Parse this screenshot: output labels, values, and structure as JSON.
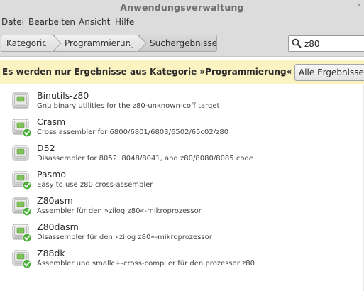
{
  "window": {
    "title": "Anwendungsverwaltung"
  },
  "menu": [
    "Datei",
    "Bearbeiten",
    "Ansicht",
    "Hilfe"
  ],
  "breadcrumbs": [
    "Kategorien",
    "Programmierung",
    "Suchergebnisse"
  ],
  "search": {
    "value": "z80",
    "icon": "search-icon"
  },
  "infobar": {
    "message": "Es werden nur Ergebnisse aus Kategorie »Programmierung« angezeigt.",
    "button_label": "Alle Ergebnisse anzeigen"
  },
  "packages": [
    {
      "name": "Binutils-z80",
      "description": "Gnu binary utilities for the z80-unknown-coff target",
      "installed": false
    },
    {
      "name": "Crasm",
      "description": "Cross assembler for 6800/6801/6803/6502/65c02/z80",
      "installed": true
    },
    {
      "name": "D52",
      "description": "Disassembler for 8052, 8048/8041, and z80/8080/8085 code",
      "installed": false
    },
    {
      "name": "Pasmo",
      "description": "Easy to use z80 cross-assembler",
      "installed": true
    },
    {
      "name": "Z80asm",
      "description": "Assembler für den »zilog z80«-mikroprozessor",
      "installed": true
    },
    {
      "name": "Z80dasm",
      "description": "Disassembler für den »zilog z80«-mikroprozessor",
      "installed": true
    },
    {
      "name": "Z88dk",
      "description": "Assembler und smallc+-cross-compiler für den prozessor z80",
      "installed": true
    }
  ],
  "colors": {
    "infobar_bg": "#fcf3c3",
    "installed_badge": "#4caf3a",
    "chrome": "#dcdcdc"
  }
}
